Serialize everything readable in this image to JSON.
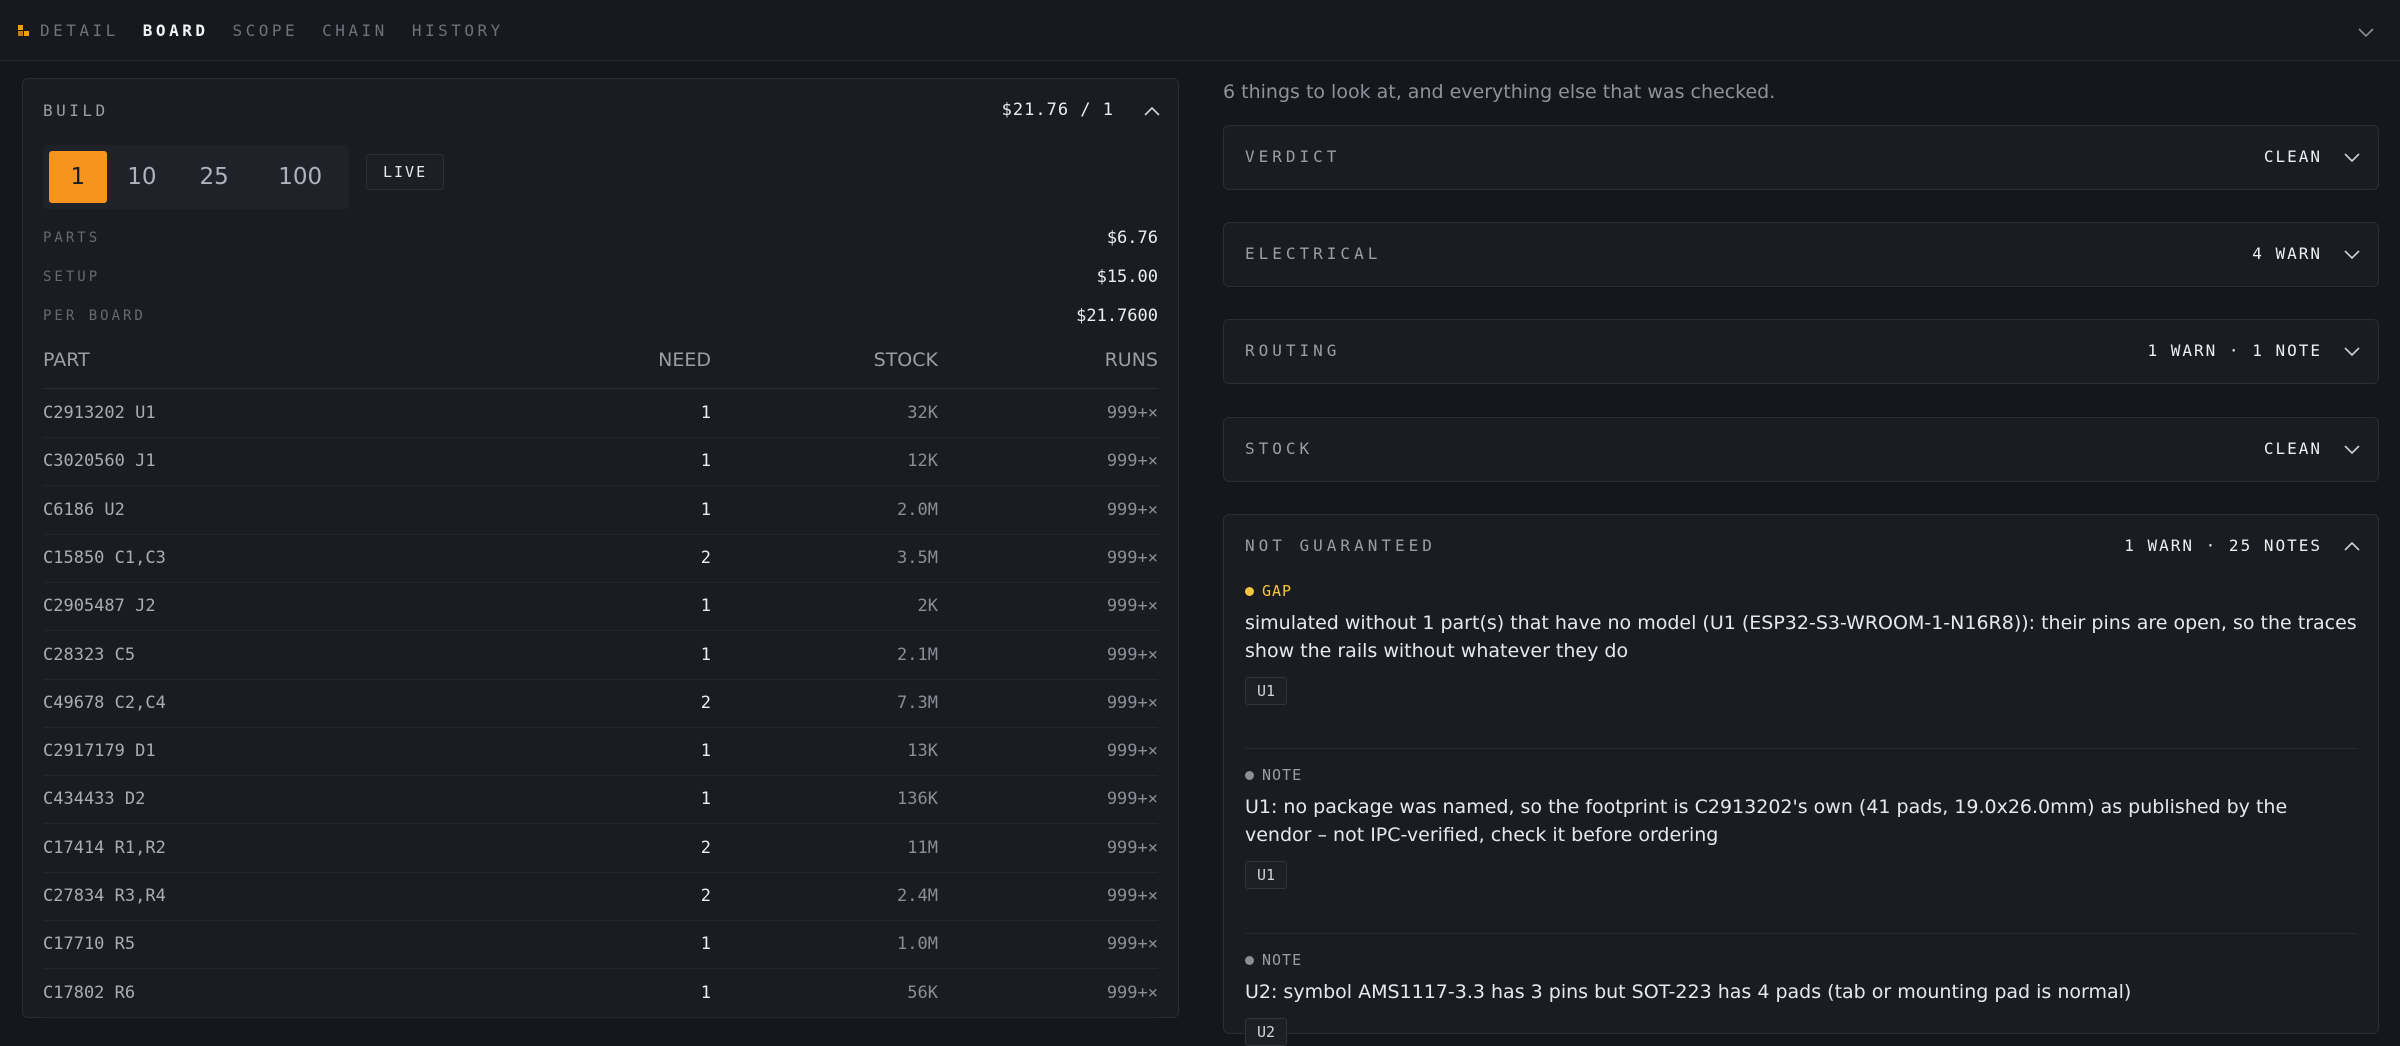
{
  "nav": {
    "tabs": [
      {
        "label": "DETAIL",
        "active": false
      },
      {
        "label": "BOARD",
        "active": true
      },
      {
        "label": "SCOPE",
        "active": false
      },
      {
        "label": "CHAIN",
        "active": false
      },
      {
        "label": "HISTORY",
        "active": false
      }
    ],
    "accent": "#f7941d"
  },
  "build": {
    "title": "BUILD",
    "total": "$21.76 / 1",
    "quantities": [
      "1",
      "10",
      "25",
      "100"
    ],
    "selected_quantity": "1",
    "live_label": "LIVE",
    "summary": [
      {
        "label": "PARTS",
        "value": "$6.76"
      },
      {
        "label": "SETUP",
        "value": "$15.00"
      },
      {
        "label": "PER BOARD",
        "value": "$21.7600"
      }
    ],
    "columns": {
      "part": "PART",
      "need": "NEED",
      "stock": "STOCK",
      "runs": "RUNS"
    },
    "rows": [
      {
        "part": "C2913202 U1",
        "need": "1",
        "stock": "32K",
        "runs": "999+×"
      },
      {
        "part": "C3020560 J1",
        "need": "1",
        "stock": "12K",
        "runs": "999+×"
      },
      {
        "part": "C6186 U2",
        "need": "1",
        "stock": "2.0M",
        "runs": "999+×"
      },
      {
        "part": "C15850 C1,C3",
        "need": "2",
        "stock": "3.5M",
        "runs": "999+×"
      },
      {
        "part": "C2905487 J2",
        "need": "1",
        "stock": "2K",
        "runs": "999+×"
      },
      {
        "part": "C28323 C5",
        "need": "1",
        "stock": "2.1M",
        "runs": "999+×"
      },
      {
        "part": "C49678 C2,C4",
        "need": "2",
        "stock": "7.3M",
        "runs": "999+×"
      },
      {
        "part": "C2917179 D1",
        "need": "1",
        "stock": "13K",
        "runs": "999+×"
      },
      {
        "part": "C434433 D2",
        "need": "1",
        "stock": "136K",
        "runs": "999+×"
      },
      {
        "part": "C17414 R1,R2",
        "need": "2",
        "stock": "11M",
        "runs": "999+×"
      },
      {
        "part": "C27834 R3,R4",
        "need": "2",
        "stock": "2.4M",
        "runs": "999+×"
      },
      {
        "part": "C17710 R5",
        "need": "1",
        "stock": "1.0M",
        "runs": "999+×"
      },
      {
        "part": "C17802 R6",
        "need": "1",
        "stock": "56K",
        "runs": "999+×"
      }
    ]
  },
  "review": {
    "subtitle": "6 things to look at, and everything else that was checked.",
    "sections": [
      {
        "title": "VERDICT",
        "status": "CLEAN",
        "expanded": false
      },
      {
        "title": "ELECTRICAL",
        "status": "4 WARN",
        "expanded": false
      },
      {
        "title": "ROUTING",
        "status": "1 WARN · 1 NOTE",
        "expanded": false
      },
      {
        "title": "STOCK",
        "status": "CLEAN",
        "expanded": false
      },
      {
        "title": "NOT GUARANTEED",
        "status": "1 WARN · 25 NOTES",
        "expanded": true
      }
    ],
    "items": [
      {
        "kind": "GAP",
        "dot_color": "#f5c542",
        "kind_color": "#f5c542",
        "text": "simulated without 1 part(s) that have no model (U1 (ESP32-S3-WROOM-1-N16R8)): their pins are open, so the traces show the rails without whatever they do",
        "ref": "U1"
      },
      {
        "kind": "NOTE",
        "dot_color": "#8a8e97",
        "kind_color": "#9a9ea7",
        "text": "U1: no package was named, so the footprint is C2913202's own (41 pads, 19.0x26.0mm) as published by the vendor – not IPC-verified, check it before ordering",
        "ref": "U1"
      },
      {
        "kind": "NOTE",
        "dot_color": "#8a8e97",
        "kind_color": "#9a9ea7",
        "text": "U2: symbol AMS1117-3.3 has 3 pins but SOT-223 has 4 pads (tab or mounting pad is normal)",
        "ref": "U2"
      }
    ]
  }
}
